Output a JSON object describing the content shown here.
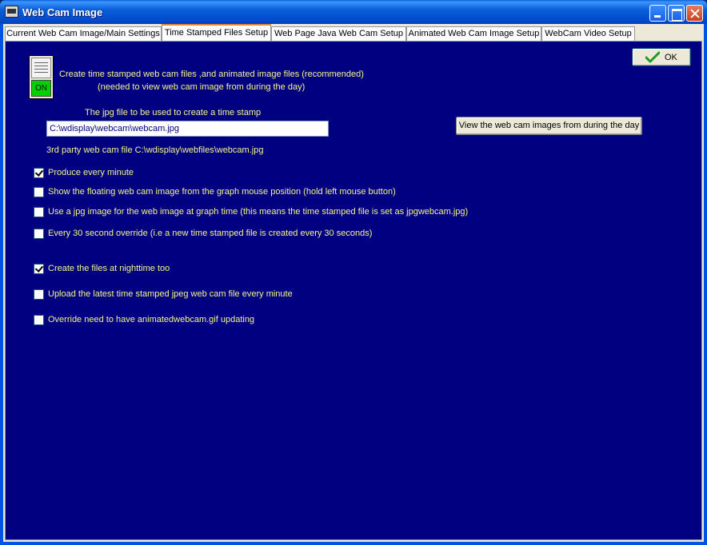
{
  "window": {
    "title": "Web Cam Image"
  },
  "tabs": [
    {
      "label": "Current Web Cam Image/Main Settings",
      "active": false
    },
    {
      "label": "Time Stamped Files Setup",
      "active": true
    },
    {
      "label": "Web Page Java Web Cam Setup",
      "active": false
    },
    {
      "label": "Animated Web Cam Image Setup",
      "active": false
    },
    {
      "label": "WebCam Video Setup",
      "active": false
    }
  ],
  "panel": {
    "toggle_label": "ON",
    "intro_line1": "Create time stamped web cam files ,and animated image files (recommended)",
    "intro_line2": "(needed to view web cam image from during the day)",
    "ok_label": "OK",
    "jpg_label": "The jpg file to be used to create a time stamp",
    "jpg_value": "C:\\wdisplay\\webcam\\webcam.jpg",
    "view_button_label": "View the web cam images from during the day",
    "third_party_label": "3rd party web cam file C:\\wdisplay\\webfiles\\webcam.jpg",
    "options": [
      {
        "label": "Produce every minute",
        "checked": true
      },
      {
        "label": "Show the floating web cam image from the graph mouse position (hold left mouse button)",
        "checked": false
      },
      {
        "label": "Use a jpg image for the web image at graph time (this means the time stamped file is set as jpgwebcam.jpg)",
        "checked": false
      },
      {
        "label": "Every 30 second override (i.e a new time stamped file is created every 30 seconds)",
        "checked": false
      },
      {
        "label": "Create the files at nighttime too",
        "checked": true
      },
      {
        "label": "Upload the latest time stamped jpeg web cam file every minute",
        "checked": false
      },
      {
        "label": "Override need to have animatedwebcam.gif updating",
        "checked": false
      }
    ]
  },
  "colors": {
    "panel_background": "#000080",
    "label_text": "#f4f48a",
    "toggle_on": "#00d000",
    "tab_highlight": "#e68b2c"
  },
  "icons": {
    "app": "webcam-app-icon",
    "ok": "green-check-icon"
  }
}
